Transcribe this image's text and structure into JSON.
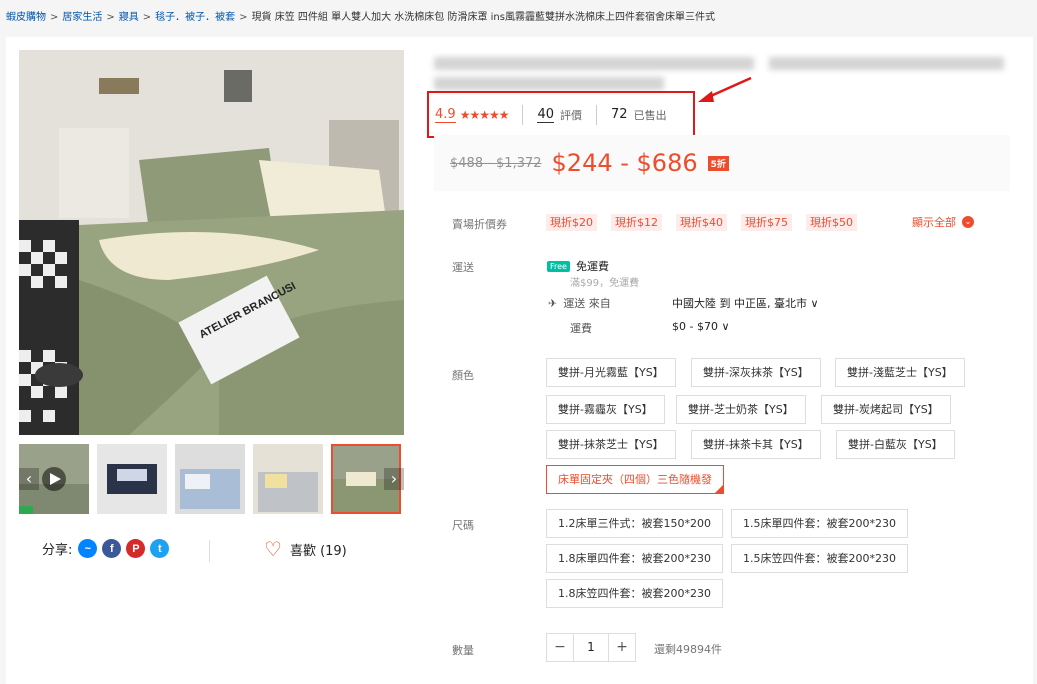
{
  "breadcrumb": {
    "items": [
      "蝦皮購物",
      "居家生活",
      "寢具",
      "毯子．被子．被套"
    ],
    "separator": ">",
    "current": "現貨 床笠 四件組 單人雙人加大 水洗棉床包 防滑床罩 ins風霧霾藍雙拼水洗棉床上四件套宿舍床單三件式"
  },
  "gallery": {
    "image_caption": "ATELIER BRANCUSI",
    "thumbnail_count": 5,
    "active_thumbnail": 5
  },
  "share": {
    "label": "分享:",
    "networks": [
      "messenger-icon",
      "facebook-icon",
      "pinterest-icon",
      "twitter-icon"
    ]
  },
  "like": {
    "label": "喜歡 (19)"
  },
  "rating": {
    "score": "4.9",
    "stars": "★★★★★",
    "reviews_count": "40",
    "reviews_label": "評價",
    "sold_count": "72",
    "sold_label": "已售出"
  },
  "price": {
    "original": "$488 - $1,372",
    "current": "$244 - $686",
    "discount": "5折"
  },
  "vouchers": {
    "label": "賣場折價券",
    "items": [
      "現折$20",
      "現折$12",
      "現折$40",
      "現折$75",
      "現折$50"
    ],
    "show_all": "顯示全部"
  },
  "shipping": {
    "label": "運送",
    "free_tag": "Free",
    "free_text": "免運費",
    "free_sub": "滿$99，免運費",
    "from_label": "運送 來自",
    "from_value": "中國大陸 到 中正區, 臺北市 ∨",
    "fee_label": "運費",
    "fee_value": "$0 - $70 ∨"
  },
  "color": {
    "label": "顏色",
    "options": [
      "雙拼-月光霧藍【YS】",
      "雙拼-深灰抹茶【YS】",
      "雙拼-淺藍芝士【YS】",
      "雙拼-霧霾灰【YS】",
      "雙拼-芝士奶茶【YS】",
      "雙拼-炭烤起司【YS】",
      "雙拼-抹茶芝士【YS】",
      "雙拼-抹茶卡其【YS】",
      "雙拼-白藍灰【YS】",
      "床單固定夾（四個）三色隨機發"
    ],
    "selected": "床單固定夾（四個）三色隨機發"
  },
  "size": {
    "label": "尺碼",
    "options": [
      "1.2床單三件式：被套150*200",
      "1.5床單四件套：被套200*230",
      "1.8床單四件套：被套200*230",
      "1.5床笠四件套：被套200*230",
      "1.8床笠四件套：被套200*230"
    ]
  },
  "quantity": {
    "label": "數量",
    "minus": "−",
    "value": "1",
    "plus": "+",
    "stock": "還剩49894件"
  },
  "colors": {
    "accent": "#ee4d2d",
    "highlight_box": "#e01818",
    "free_tag": "#00bfa5"
  }
}
